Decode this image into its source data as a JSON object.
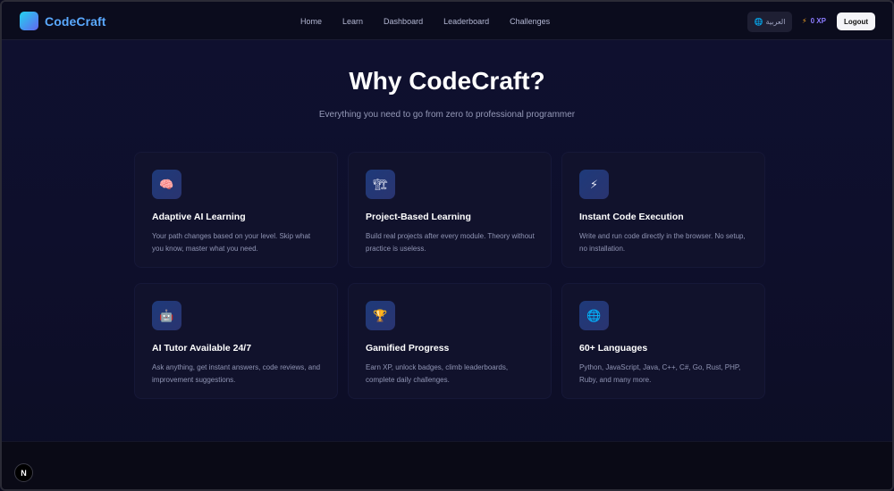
{
  "brand": {
    "name": "CodeCraft",
    "logo_icon": "codecraft-logo"
  },
  "nav": {
    "links": [
      "Home",
      "Learn",
      "Dashboard",
      "Leaderboard",
      "Challenges"
    ],
    "language_label": "العربية",
    "language_icon": "globe-icon",
    "xp_label": "0 XP",
    "xp_icon": "lightning-icon",
    "logout_label": "Logout"
  },
  "hero": {
    "title": "Why CodeCraft?",
    "subtitle": "Everything you need to go from zero to professional programmer"
  },
  "features": [
    {
      "icon": "brain-icon",
      "glyph": "🧠",
      "title": "Adaptive AI Learning",
      "description": "Your path changes based on your level. Skip what you know, master what you need."
    },
    {
      "icon": "building-icon",
      "glyph": "🏗",
      "title": "Project-Based Learning",
      "description": "Build real projects after every module. Theory without practice is useless."
    },
    {
      "icon": "lightning-icon",
      "glyph": "⚡",
      "title": "Instant Code Execution",
      "description": "Write and run code directly in the browser. No setup, no installation."
    },
    {
      "icon": "robot-icon",
      "glyph": "🤖",
      "title": "AI Tutor Available 24/7",
      "description": "Ask anything, get instant answers, code reviews, and improvement suggestions."
    },
    {
      "icon": "trophy-icon",
      "glyph": "🏆",
      "title": "Gamified Progress",
      "description": "Earn XP, unlock badges, climb leaderboards, complete daily challenges."
    },
    {
      "icon": "globe-icon",
      "glyph": "🌐",
      "title": "60+ Languages",
      "description": "Python, JavaScript, Java, C++, C#, Go, Rust, PHP, Ruby, and many more."
    }
  ],
  "footer": {
    "badge_label": "N"
  },
  "colors": {
    "accent": "#5aa9ff",
    "xp": "#8c7cff",
    "bolt": "#f5a524"
  }
}
